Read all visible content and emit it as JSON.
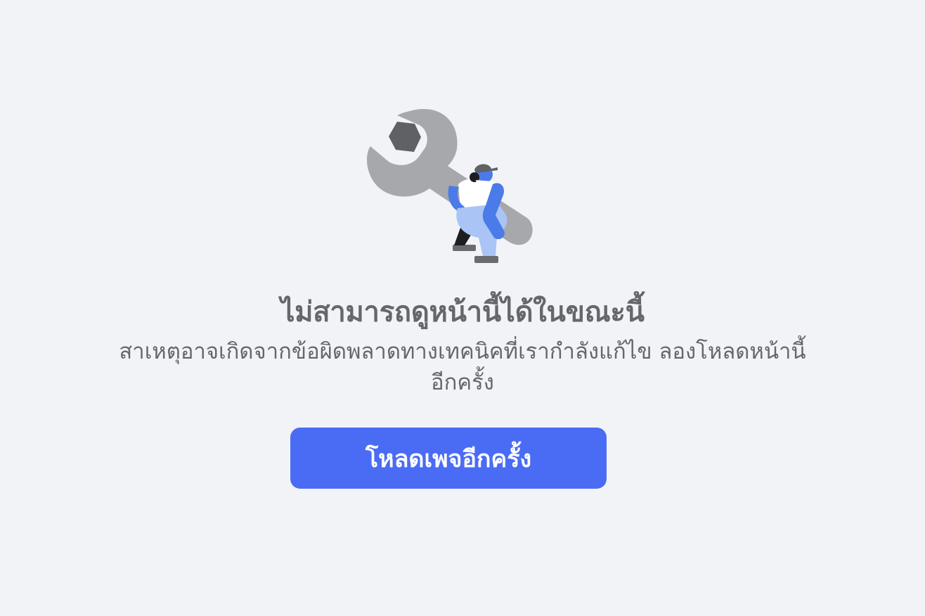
{
  "illustration": {
    "icon": "wrench-worker-illustration"
  },
  "error": {
    "title": "ไม่สามารถดูหน้านี้ได้ในขณะนี้",
    "message": "สาเหตุอาจเกิดจากข้อผิดพลาดทางเทคนิคที่เรากำลังแก้ไข ลองโหลดหน้านี้อีกครั้ง"
  },
  "actions": {
    "reload_label": "โหลดเพจอีกครั้ง"
  },
  "colors": {
    "background": "#f2f3f7",
    "text": "#65676b",
    "button": "#4a6cf5",
    "button_text": "#ffffff"
  }
}
